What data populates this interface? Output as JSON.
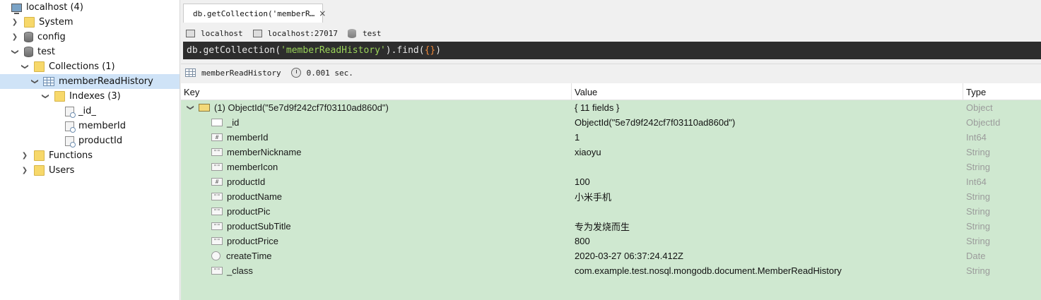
{
  "sidebar": {
    "server": "localhost (4)",
    "system": "System",
    "config": "config",
    "test": "test",
    "collections": "Collections (1)",
    "collection": "memberReadHistory",
    "indexes": "Indexes (3)",
    "index_items": [
      "_id_",
      "memberId",
      "productId"
    ],
    "functions": "Functions",
    "users": "Users"
  },
  "tab": {
    "label": "db.getCollection('memberR…",
    "close": "×"
  },
  "connection": {
    "host": "localhost",
    "address": "localhost:27017",
    "database": "test"
  },
  "query": {
    "prefix": "db.getCollection(",
    "collection": "'memberReadHistory'",
    "middle": ").find(",
    "braces": "{}",
    "suffix": ")"
  },
  "result_info": {
    "collection": "memberReadHistory",
    "time": "0.001 sec."
  },
  "table": {
    "headers": {
      "key": "Key",
      "value": "Value",
      "type": "Type"
    },
    "document": {
      "key": "(1) ObjectId(\"5e7d9f242cf7f03110ad860d\")",
      "value": "{ 11 fields }",
      "type": "Object"
    },
    "fields": [
      {
        "key": "_id",
        "value": "ObjectId(\"5e7d9f242cf7f03110ad860d\")",
        "type": "ObjectId",
        "icon": "objectid-icon"
      },
      {
        "key": "memberId",
        "value": "1",
        "type": "Int64",
        "icon": "number-icon"
      },
      {
        "key": "memberNickname",
        "value": "xiaoyu",
        "type": "String",
        "icon": "string-icon"
      },
      {
        "key": "memberIcon",
        "value": "",
        "type": "String",
        "icon": "string-icon"
      },
      {
        "key": "productId",
        "value": "100",
        "type": "Int64",
        "icon": "number-icon"
      },
      {
        "key": "productName",
        "value": "小米手机",
        "type": "String",
        "icon": "string-icon"
      },
      {
        "key": "productPic",
        "value": "",
        "type": "String",
        "icon": "string-icon"
      },
      {
        "key": "productSubTitle",
        "value": "专为发烧而生",
        "type": "String",
        "icon": "string-icon"
      },
      {
        "key": "productPrice",
        "value": "800",
        "type": "String",
        "icon": "string-icon"
      },
      {
        "key": "createTime",
        "value": "2020-03-27 06:37:24.412Z",
        "type": "Date",
        "icon": "date-icon"
      },
      {
        "key": "_class",
        "value": "com.example.test.nosql.mongodb.document.MemberReadHistory",
        "type": "String",
        "icon": "string-icon"
      }
    ]
  },
  "colors": {
    "selected_row": "#cfe3f7",
    "result_rows": "#cfe8d0",
    "query_bg": "#2d2d2d",
    "query_string": "#9ad35a"
  }
}
